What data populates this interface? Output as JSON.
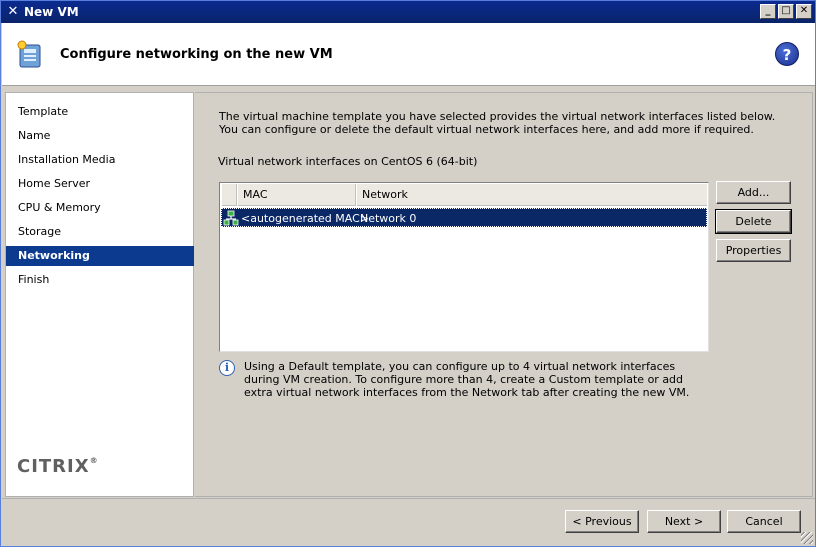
{
  "window": {
    "title": "New VM",
    "app_icon": "x-icon"
  },
  "header": {
    "title": "Configure networking on the new VM",
    "help_label": "?"
  },
  "sidebar": {
    "items": [
      {
        "label": "Template"
      },
      {
        "label": "Name"
      },
      {
        "label": "Installation Media"
      },
      {
        "label": "Home Server"
      },
      {
        "label": "CPU & Memory"
      },
      {
        "label": "Storage"
      },
      {
        "label": "Networking",
        "active": true
      },
      {
        "label": "Finish"
      }
    ],
    "logo_text": "CITRIX",
    "logo_reg": "®"
  },
  "main": {
    "intro": "The virtual machine template you have selected provides the virtual network interfaces listed below. You can configure or delete the default virtual network interfaces here, and add more if required.",
    "ifaces_label": "Virtual network interfaces on CentOS 6 (64-bit)",
    "table": {
      "columns": [
        "MAC",
        "Network"
      ],
      "rows": [
        {
          "mac": "<autogenerated MAC>",
          "network": "Network 0",
          "selected": true
        }
      ]
    },
    "buttons": {
      "add": "Add...",
      "delete": "Delete",
      "properties": "Properties"
    },
    "info": "Using a Default template, you can configure up to 4 virtual network interfaces during VM creation. To configure more than 4, create a Custom template or add extra virtual network interfaces from the Network tab after creating the new VM."
  },
  "footer": {
    "previous": "< Previous",
    "next": "Next >",
    "cancel": "Cancel"
  },
  "colors": {
    "titlebar": "#0a246a",
    "selection": "#0b3a8e"
  }
}
